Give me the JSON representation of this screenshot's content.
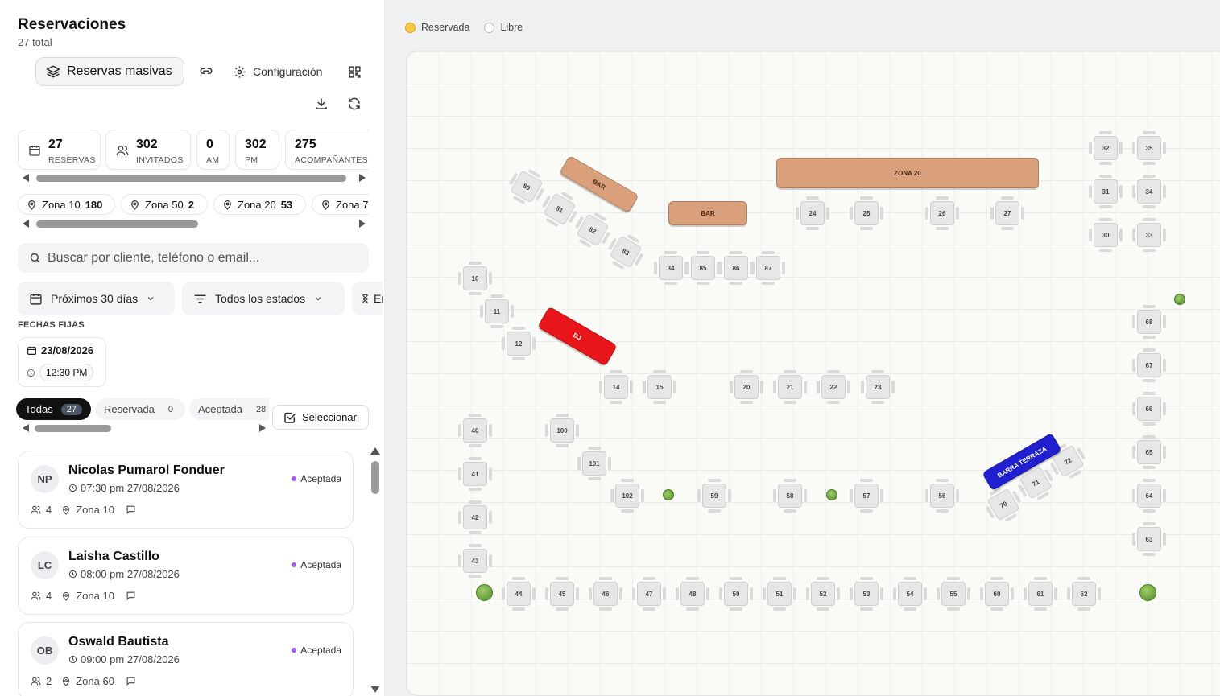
{
  "sidebar": {
    "title": "Reservaciones",
    "subtitle": "27 total",
    "bulk_button": "Reservas masivas",
    "config_button": "Configuración",
    "stats": [
      {
        "value": "27",
        "label": "RESERVAS",
        "icon": "calendar-icon"
      },
      {
        "value": "302",
        "label": "INVITADOS",
        "icon": "users-icon"
      },
      {
        "value": "0",
        "label": "AM"
      },
      {
        "value": "302",
        "label": "PM"
      },
      {
        "value": "275",
        "label": "ACOMPAÑANTES"
      }
    ],
    "zones": [
      {
        "name": "Zona 10",
        "count": "180"
      },
      {
        "name": "Zona 50",
        "count": "2"
      },
      {
        "name": "Zona 20",
        "count": "53"
      },
      {
        "name": "Zona 7",
        "count": ""
      }
    ],
    "search_placeholder": "Buscar por cliente, teléfono o email...",
    "filters": {
      "range": "Próximos 30 días",
      "status": "Todos los estados",
      "waiting": "En esp"
    },
    "fixed_dates_label": "FECHAS FIJAS",
    "fixed_date": {
      "date": "23/08/2026",
      "time": "12:30 PM"
    },
    "tabs": [
      {
        "label": "Todas",
        "count": "27",
        "active": true
      },
      {
        "label": "Reservada",
        "count": "0",
        "active": false
      },
      {
        "label": "Aceptada",
        "count": "28",
        "active": false
      }
    ],
    "select_button": "Seleccionar",
    "reservations": [
      {
        "initials": "NP",
        "name": "Nicolas Pumarol Fonduer",
        "time": "07:30 pm 27/08/2026",
        "status": "Aceptada",
        "guests": "4",
        "zone": "Zona 10"
      },
      {
        "initials": "LC",
        "name": "Laisha Castillo",
        "time": "08:00 pm 27/08/2026",
        "status": "Aceptada",
        "guests": "4",
        "zone": "Zona 10"
      },
      {
        "initials": "OB",
        "name": "Oswald Bautista",
        "time": "09:00 pm 27/08/2026",
        "status": "Aceptada",
        "guests": "2",
        "zone": "Zona 60"
      }
    ]
  },
  "legend": [
    {
      "label": "Reservada",
      "color": "#f7c948"
    },
    {
      "label": "Libre",
      "color": "#ffffff"
    }
  ],
  "floor": {
    "features": [
      {
        "label": "BAR",
        "color": "#d9a07b"
      },
      {
        "label": "BAR",
        "color": "#d9a07b"
      },
      {
        "label": "ZONA 20",
        "color": "#d9a07b"
      },
      {
        "label": "DJ",
        "color": "#e8161b"
      },
      {
        "label": "BARRA TERRAZA",
        "color": "#2020d0"
      }
    ],
    "tables": [
      "80",
      "81",
      "82",
      "83",
      "84",
      "85",
      "86",
      "87",
      "24",
      "25",
      "26",
      "27",
      "32",
      "35",
      "31",
      "34",
      "30",
      "33",
      "10",
      "11",
      "12",
      "14",
      "15",
      "20",
      "21",
      "22",
      "23",
      "68",
      "67",
      "66",
      "65",
      "64",
      "63",
      "40",
      "41",
      "42",
      "43",
      "100",
      "101",
      "102",
      "59",
      "58",
      "57",
      "56",
      "72",
      "71",
      "70",
      "44",
      "45",
      "46",
      "47",
      "48",
      "50",
      "51",
      "52",
      "53",
      "54",
      "55",
      "60",
      "61",
      "62"
    ]
  }
}
